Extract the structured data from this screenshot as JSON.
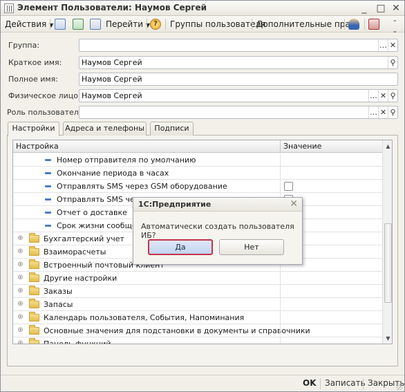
{
  "window": {
    "title": "Элемент Пользователи: Наумов Сергей",
    "controls": [
      "_",
      "□",
      "✕"
    ]
  },
  "toolbar": {
    "actions_label": "Действия",
    "goto_label": "Перейти",
    "groups_label": "Группы пользователя",
    "extra_rights_label": "Дополнительные права"
  },
  "fields": {
    "group_label": "Группа:",
    "group_value": "",
    "short_name_label": "Краткое имя:",
    "short_name_value": "Наумов Сергей",
    "full_name_label": "Полное имя:",
    "full_name_value": "Наумов Сергей",
    "person_label": "Физическое лицо:",
    "person_value": "Наумов Сергей",
    "role_label": "Роль пользователя:",
    "role_value": ""
  },
  "tabs": [
    {
      "label": "Настройки",
      "active": true
    },
    {
      "label": "Адреса и телефоны",
      "active": false
    },
    {
      "label": "Подписи",
      "active": false
    }
  ],
  "grid": {
    "col_setting": "Настройка",
    "col_value": "Значение",
    "rows": [
      {
        "label": "Номер отправителя по умолчанию",
        "kind": "item",
        "checkbox": false
      },
      {
        "label": "Окончание периода в часах",
        "kind": "item",
        "checkbox": false
      },
      {
        "label": "Отправлять SMS через GSM оборудование",
        "kind": "item",
        "checkbox": true
      },
      {
        "label": "Отправлять SMS через",
        "kind": "item",
        "checkbox": true
      },
      {
        "label": "Отчет о доставке",
        "kind": "item",
        "checkbox": false
      },
      {
        "label": "Срок жизни сообщен",
        "kind": "item",
        "checkbox": false
      },
      {
        "label": "Бухгалтерский учет",
        "kind": "group"
      },
      {
        "label": "Взаиморасчеты",
        "kind": "group"
      },
      {
        "label": "Встроенный почтовый клиент",
        "kind": "group"
      },
      {
        "label": "Другие настройки",
        "kind": "group"
      },
      {
        "label": "Заказы",
        "kind": "group"
      },
      {
        "label": "Запасы",
        "kind": "group"
      },
      {
        "label": "Календарь пользователя, События, Напоминания",
        "kind": "group"
      },
      {
        "label": "Основные значения для подстановки в документы и справочники",
        "kind": "group"
      },
      {
        "label": "Панель функций",
        "kind": "group"
      }
    ]
  },
  "dialog": {
    "title": "1С:Предприятие",
    "message": "Автоматически создать пользователя ИБ?",
    "yes_label": "Да",
    "no_label": "Нет"
  },
  "footer": {
    "ok_label": "OK",
    "save_label": "Записать",
    "close_label": "Закрыть"
  },
  "colors": {
    "accent_border": "#c2334a",
    "item_marker": "#4a7bc2",
    "folder": "#e3bd4c"
  }
}
